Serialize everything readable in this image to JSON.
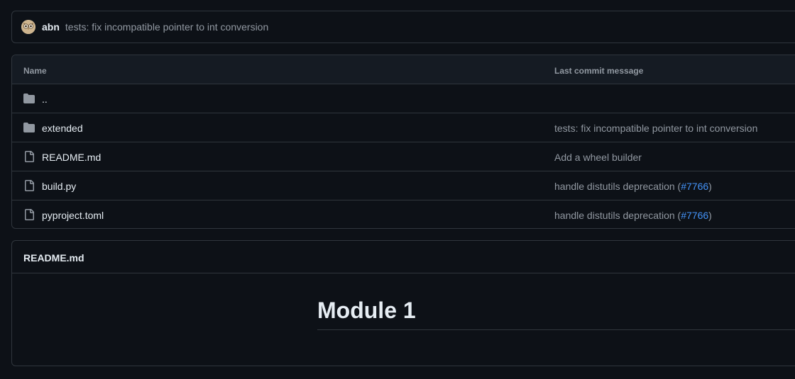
{
  "latest_commit": {
    "author": "abn",
    "message": "tests: fix incompatible pointer to int conversion",
    "avatar_icon": "owl-avatar-icon"
  },
  "file_table": {
    "headers": {
      "name": "Name",
      "last_commit_message": "Last commit message"
    },
    "rows": [
      {
        "name": "..",
        "type": "folder",
        "icon": "folder-icon",
        "message": "",
        "pr": ""
      },
      {
        "name": "extended",
        "type": "folder",
        "icon": "folder-icon",
        "message": "tests: fix incompatible pointer to int conversion",
        "pr": ""
      },
      {
        "name": "README.md",
        "type": "file",
        "icon": "file-icon",
        "message": "Add a wheel builder",
        "pr": ""
      },
      {
        "name": "build.py",
        "type": "file",
        "icon": "file-icon",
        "message": "handle distutils deprecation (",
        "pr": "#7766",
        "suffix": ")"
      },
      {
        "name": "pyproject.toml",
        "type": "file",
        "icon": "file-icon",
        "message": "handle distutils deprecation (",
        "pr": "#7766",
        "suffix": ")"
      }
    ]
  },
  "readme": {
    "title": "README.md",
    "heading": "Module 1"
  },
  "colors": {
    "background": "#0d1117",
    "border": "#30363d",
    "header_bg": "#151b23",
    "muted_text": "#9198a1",
    "link": "#4493f8"
  }
}
